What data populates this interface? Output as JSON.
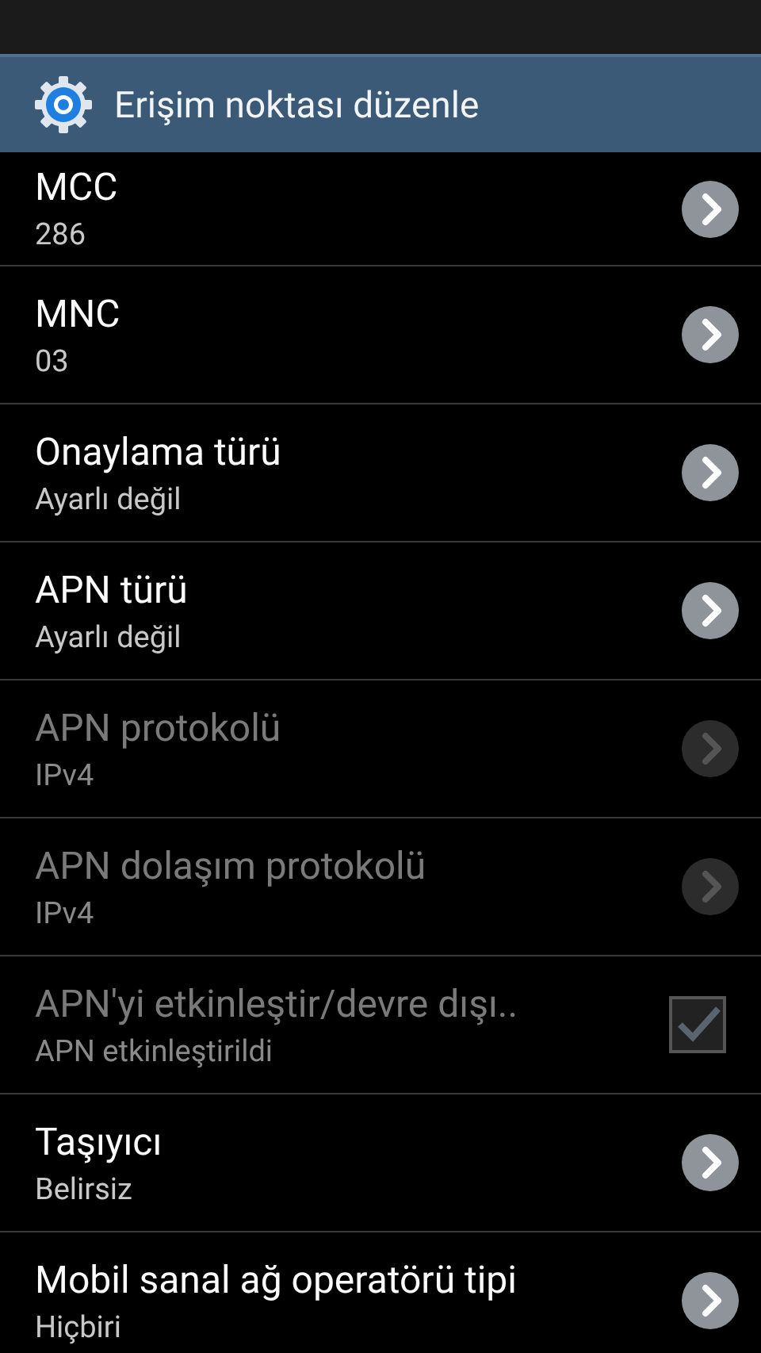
{
  "action_bar": {
    "title": "Erişim noktası düzenle"
  },
  "settings": [
    {
      "kind": "link",
      "title": "MCC",
      "summary": "286",
      "disabled": false
    },
    {
      "kind": "link",
      "title": "MNC",
      "summary": "03",
      "disabled": false
    },
    {
      "kind": "link",
      "title": "Onaylama türü",
      "summary": "Ayarlı değil",
      "disabled": false
    },
    {
      "kind": "link",
      "title": "APN türü",
      "summary": "Ayarlı değil",
      "disabled": false
    },
    {
      "kind": "link",
      "title": "APN protokolü",
      "summary": "IPv4",
      "disabled": true
    },
    {
      "kind": "link",
      "title": "APN dolaşım protokolü",
      "summary": "IPv4",
      "disabled": true
    },
    {
      "kind": "checkbox",
      "title": "APN'yi etkinleştir/devre dışı..",
      "summary": "APN etkinleştirildi",
      "disabled": true,
      "checked": true
    },
    {
      "kind": "link",
      "title": "Taşıyıcı",
      "summary": "Belirsiz",
      "disabled": false
    },
    {
      "kind": "link",
      "title": "Mobil sanal ağ operatörü tipi",
      "summary": "Hiçbiri",
      "disabled": false
    }
  ]
}
